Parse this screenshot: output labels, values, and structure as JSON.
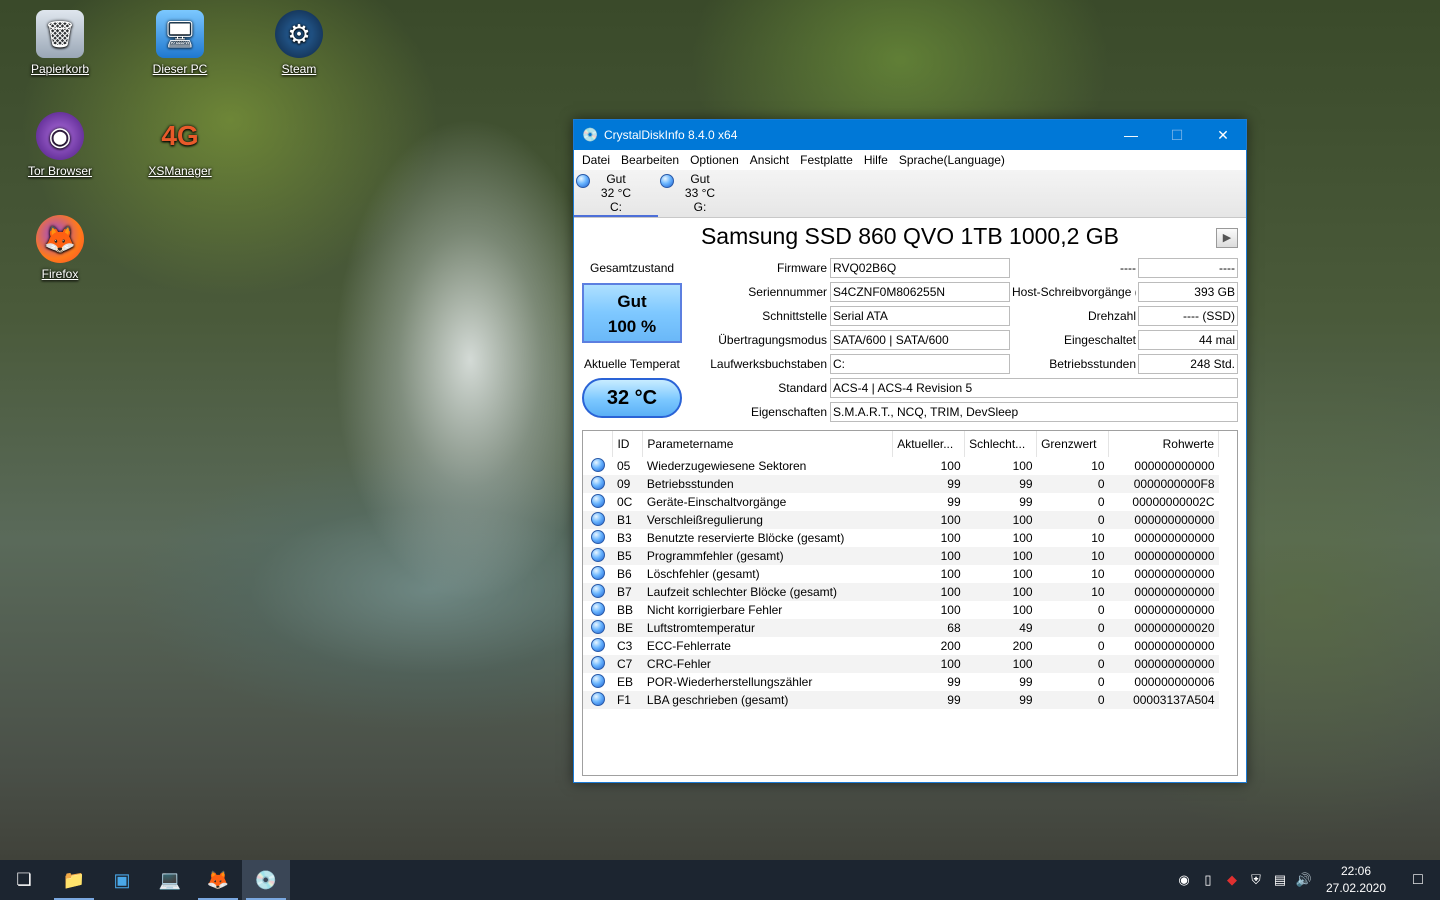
{
  "desktop": {
    "icons": [
      {
        "label": "Papierkorb",
        "glyph": "🗑"
      },
      {
        "label": "Dieser PC",
        "glyph": "🖥"
      },
      {
        "label": "Steam",
        "glyph": "⚙"
      },
      {
        "label": "Tor Browser",
        "glyph": "◉"
      },
      {
        "label": "XSManager",
        "glyph": "4G"
      },
      {
        "label": "Firefox",
        "glyph": "🦊"
      }
    ]
  },
  "window": {
    "title": "CrystalDiskInfo 8.4.0 x64",
    "menu": [
      "Datei",
      "Bearbeiten",
      "Optionen",
      "Ansicht",
      "Festplatte",
      "Hilfe",
      "Sprache(Language)"
    ],
    "drives": [
      {
        "status": "Gut",
        "temp": "32 °C",
        "letter": "C:"
      },
      {
        "status": "Gut",
        "temp": "33 °C",
        "letter": "G:"
      }
    ],
    "model": "Samsung SSD 860 QVO 1TB 1000,2 GB",
    "health_label": "Gesamtzustand",
    "health_status": "Gut",
    "health_percent": "100 %",
    "temp_label": "Aktuelle Temperat",
    "temp_value": "32 °C",
    "fields": {
      "firmware_label": "Firmware",
      "firmware": "RVQ02B6Q",
      "serial_label": "Seriennummer",
      "serial": "S4CZNF0M806255N",
      "interface_label": "Schnittstelle",
      "interface": "Serial ATA",
      "transfer_label": "Übertragungsmodus",
      "transfer": "SATA/600 | SATA/600",
      "letters_label": "Laufwerksbuchstaben",
      "letters": "C:",
      "standard_label": "Standard",
      "standard": "ACS-4 | ACS-4 Revision 5",
      "features_label": "Eigenschaften",
      "features": "S.M.A.R.T., NCQ, TRIM, DevSleep",
      "r1_label": "----",
      "r1": "----",
      "writes_label": "Host-Schreibvorgänge (",
      "writes": "393 GB",
      "rpm_label": "Drehzahl",
      "rpm": "---- (SSD)",
      "poweron_label": "Eingeschaltet",
      "poweron": "44 mal",
      "hours_label": "Betriebsstunden",
      "hours": "248 Std."
    },
    "smart_headers": [
      "ID",
      "Parametername",
      "Aktueller...",
      "Schlecht...",
      "Grenzwert",
      "Rohwerte"
    ],
    "smart_rows": [
      [
        "05",
        "Wiederzugewiesene Sektoren",
        "100",
        "100",
        "10",
        "000000000000"
      ],
      [
        "09",
        "Betriebsstunden",
        "99",
        "99",
        "0",
        "0000000000F8"
      ],
      [
        "0C",
        "Geräte-Einschaltvorgänge",
        "99",
        "99",
        "0",
        "00000000002C"
      ],
      [
        "B1",
        "Verschleißregulierung",
        "100",
        "100",
        "0",
        "000000000000"
      ],
      [
        "B3",
        "Benutzte reservierte Blöcke (gesamt)",
        "100",
        "100",
        "10",
        "000000000000"
      ],
      [
        "B5",
        "Programmfehler (gesamt)",
        "100",
        "100",
        "10",
        "000000000000"
      ],
      [
        "B6",
        "Löschfehler (gesamt)",
        "100",
        "100",
        "10",
        "000000000000"
      ],
      [
        "B7",
        "Laufzeit schlechter Blöcke (gesamt)",
        "100",
        "100",
        "10",
        "000000000000"
      ],
      [
        "BB",
        "Nicht korrigierbare Fehler",
        "100",
        "100",
        "0",
        "000000000000"
      ],
      [
        "BE",
        "Luftstromtemperatur",
        "68",
        "49",
        "0",
        "000000000020"
      ],
      [
        "C3",
        "ECC-Fehlerrate",
        "200",
        "200",
        "0",
        "000000000000"
      ],
      [
        "C7",
        "CRC-Fehler",
        "100",
        "100",
        "0",
        "000000000000"
      ],
      [
        "EB",
        "POR-Wiederherstellungszähler",
        "99",
        "99",
        "0",
        "000000000006"
      ],
      [
        "F1",
        "LBA geschrieben (gesamt)",
        "99",
        "99",
        "0",
        "00003137A504"
      ]
    ]
  },
  "taskbar": {
    "time": "22:06",
    "date": "27.02.2020"
  }
}
